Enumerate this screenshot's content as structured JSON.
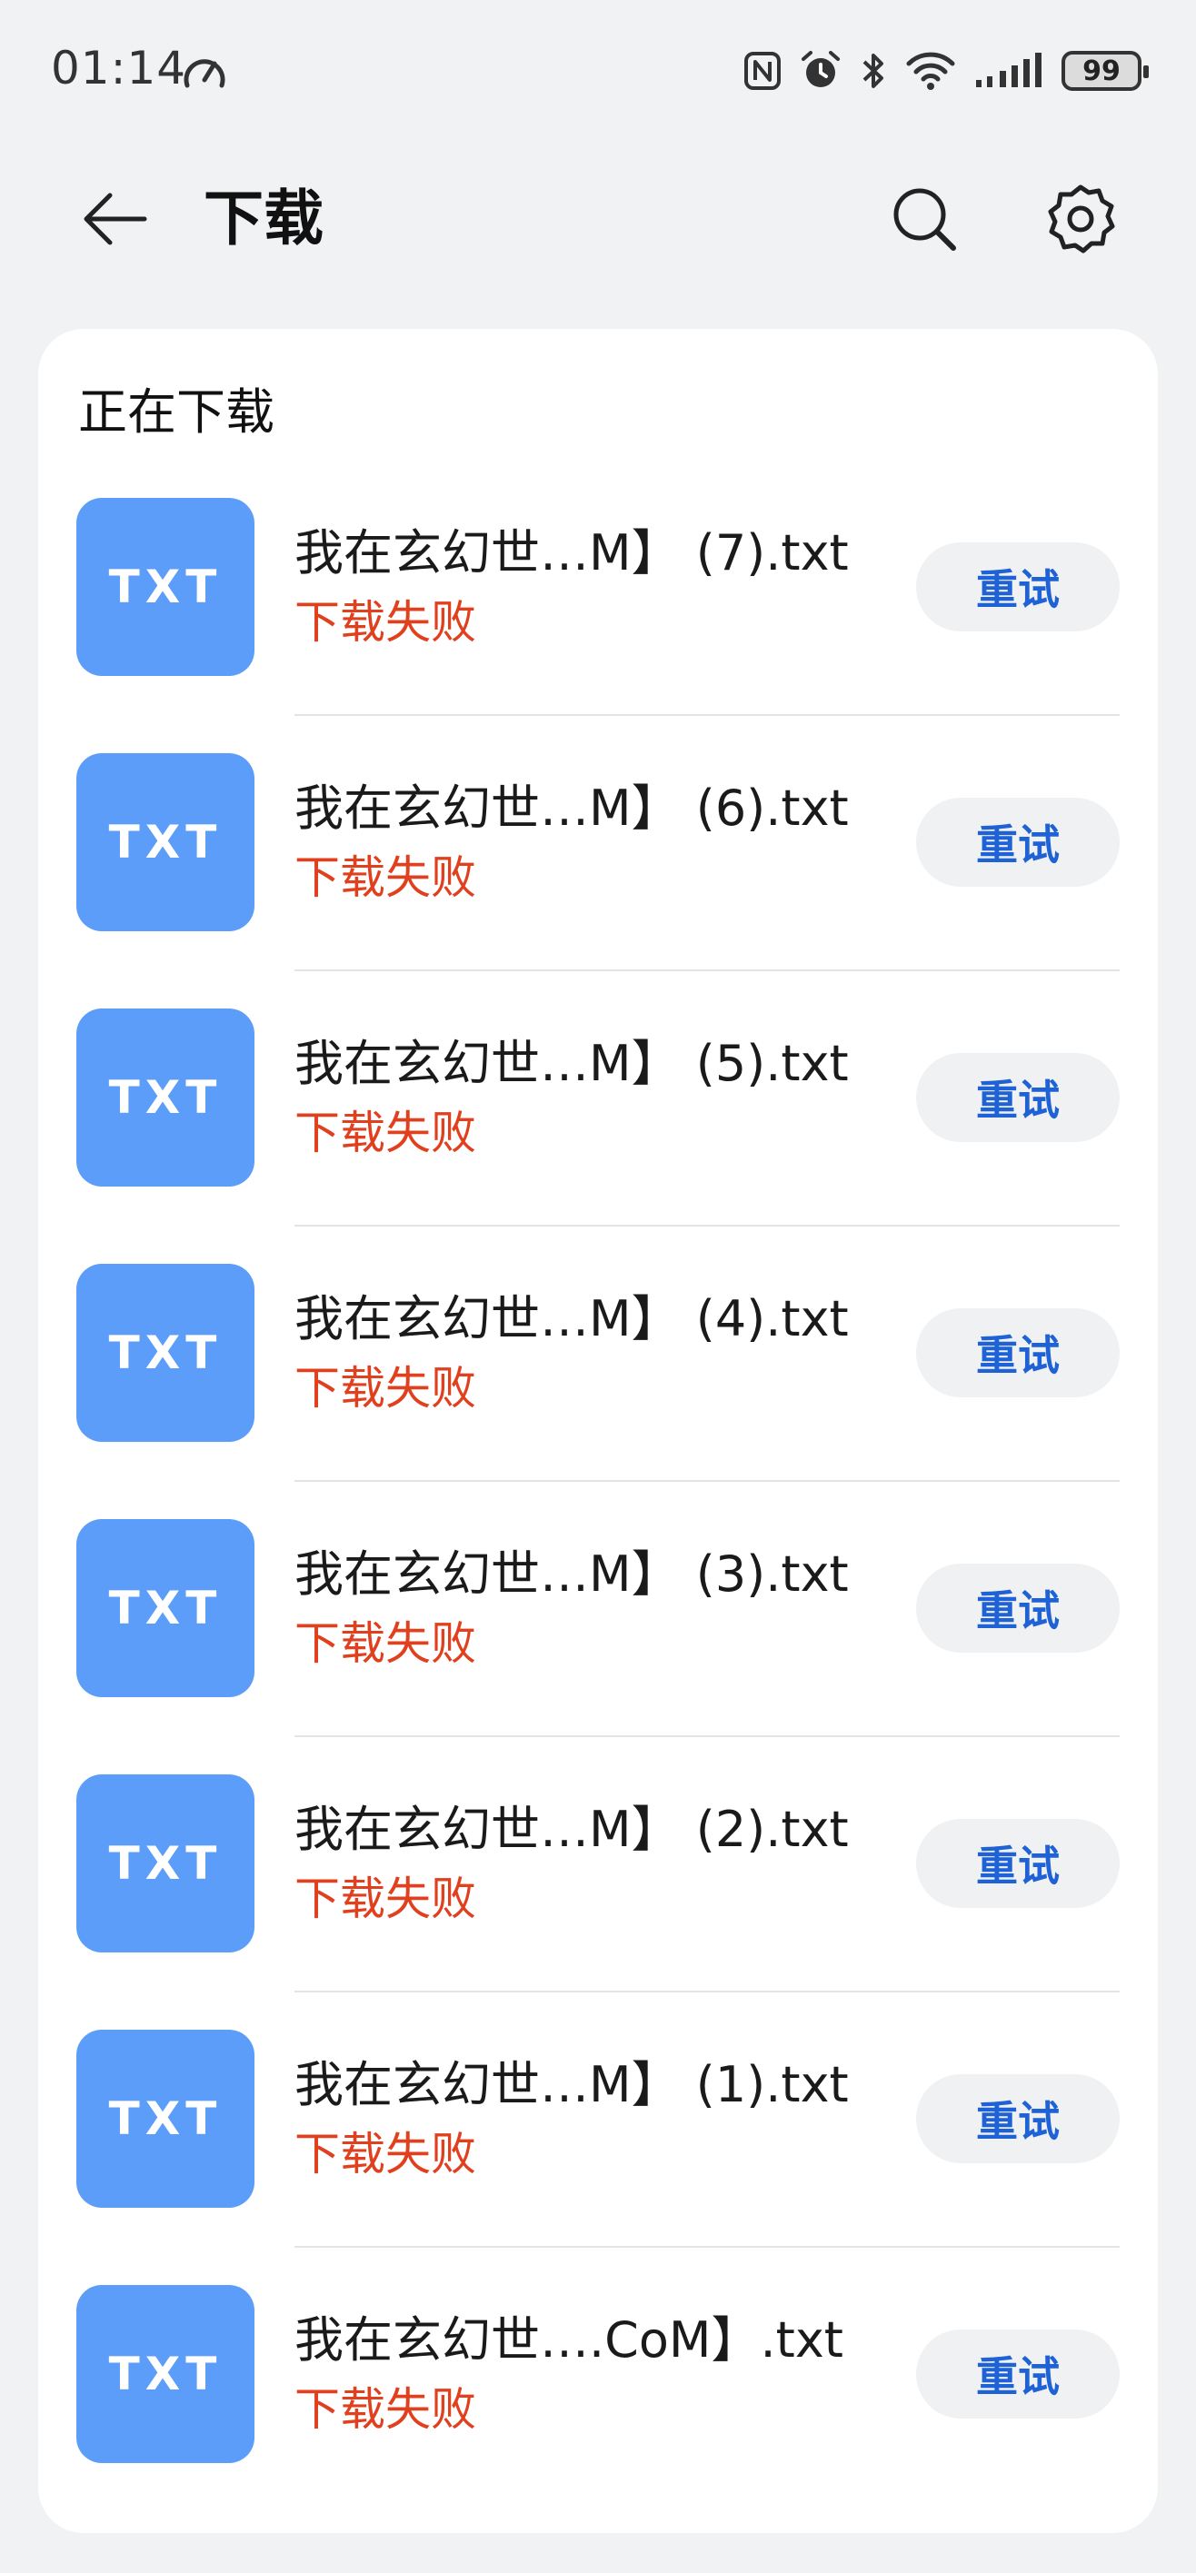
{
  "status_bar": {
    "time": "01:14",
    "battery": "99"
  },
  "header": {
    "title": "下载"
  },
  "section": {
    "title": "正在下载"
  },
  "files": [
    {
      "icon_label": "TXT",
      "name": "我在玄幻世…M】 (7).txt",
      "status": "下载失败",
      "action": "重试"
    },
    {
      "icon_label": "TXT",
      "name": "我在玄幻世…M】 (6).txt",
      "status": "下载失败",
      "action": "重试"
    },
    {
      "icon_label": "TXT",
      "name": "我在玄幻世…M】 (5).txt",
      "status": "下载失败",
      "action": "重试"
    },
    {
      "icon_label": "TXT",
      "name": "我在玄幻世…M】 (4).txt",
      "status": "下载失败",
      "action": "重试"
    },
    {
      "icon_label": "TXT",
      "name": "我在玄幻世…M】 (3).txt",
      "status": "下载失败",
      "action": "重试"
    },
    {
      "icon_label": "TXT",
      "name": "我在玄幻世…M】 (2).txt",
      "status": "下载失败",
      "action": "重试"
    },
    {
      "icon_label": "TXT",
      "name": "我在玄幻世…M】 (1).txt",
      "status": "下载失败",
      "action": "重试"
    },
    {
      "icon_label": "TXT",
      "name": "我在玄幻世….CoM】.txt",
      "status": "下载失败",
      "action": "重试"
    }
  ],
  "colors": {
    "accent": "#1f62d6",
    "error": "#e0401e",
    "file_icon": "#5b9df8",
    "background": "#f1f2f4"
  },
  "icons": {
    "back": "arrow-left-icon",
    "search": "search-icon",
    "settings": "gear-icon",
    "nfc": "nfc-icon",
    "alarm": "alarm-icon",
    "bluetooth": "bluetooth-icon",
    "wifi": "wifi-icon",
    "signal": "signal-icon",
    "battery": "battery-icon",
    "speed": "speed-icon"
  }
}
